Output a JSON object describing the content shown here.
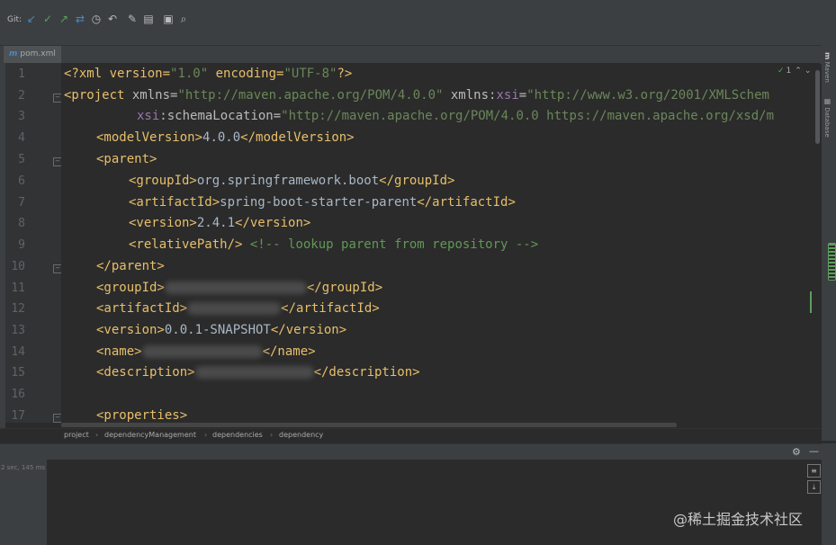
{
  "toolbar": {
    "git_label": "Git:",
    "icons": [
      "update-icon",
      "commit-icon",
      "push-icon",
      "merge-icon",
      "history-icon",
      "rollback-icon",
      "settings-icon",
      "folder-icon",
      "window-icon",
      "search-icon"
    ]
  },
  "tab": {
    "icon_text": "m",
    "filename": "pom.xml"
  },
  "gutter": {
    "line_numbers": [
      "1",
      "2",
      "3",
      "4",
      "5",
      "6",
      "7",
      "8",
      "9",
      "10",
      "11",
      "12",
      "13",
      "14",
      "15",
      "16",
      "17"
    ]
  },
  "code": {
    "l1_a": "<?xml version=",
    "l1_b": "\"1.0\"",
    "l1_c": " encoding=",
    "l1_d": "\"UTF-8\"",
    "l1_e": "?>",
    "l2_a": "<project ",
    "l2_b": "xmlns=",
    "l2_c": "\"http://maven.apache.org/POM/4.0.0\"",
    "l2_d": " xmlns:",
    "l2_e": "xsi",
    "l2_f": "=",
    "l2_g": "\"http://www.w3.org/2001/XMLSchem",
    "l3_a": "xsi",
    "l3_b": ":schemaLocation=",
    "l3_c": "\"http://maven.apache.org/POM/4.0.0 https://maven.apache.org/xsd/m",
    "l4_a": "<modelVersion>",
    "l4_b": "4.0.0",
    "l4_c": "</modelVersion>",
    "l5_a": "<parent>",
    "l6_a": "<groupId>",
    "l6_b": "org.springframework.boot",
    "l6_c": "</groupId>",
    "l7_a": "<artifactId>",
    "l7_b": "spring-boot-starter-parent",
    "l7_c": "</artifactId>",
    "l8_a": "<version>",
    "l8_b": "2.4.1",
    "l8_c": "</version>",
    "l9_a": "<relativePath/>",
    "l9_b": " <!-- lookup parent from repository -->",
    "l10_a": "</parent>",
    "l11_a": "<groupId>",
    "l11_c": "</groupId>",
    "l12_a": "<artifactId>",
    "l12_c": "</artifactId>",
    "l13_a": "<version>",
    "l13_b": "0.0.1-SNAPSHOT",
    "l13_c": "</version>",
    "l14_a": "<name>",
    "l14_c": "</name>",
    "l15_a": "<description>",
    "l15_c": "</description>",
    "l17_a": "<properties>"
  },
  "inspection": {
    "check": "✓",
    "count": "1"
  },
  "right_tools": {
    "maven": "Maven",
    "database": "Database"
  },
  "breadcrumbs": [
    "project",
    "dependencyManagement",
    "dependencies",
    "dependency"
  ],
  "bottom": {
    "status": "2 sec, 145 ms"
  },
  "watermark": "@稀土掘金技术社区",
  "colors": {
    "tag": "#e8bf6a",
    "string": "#6a8759",
    "comment": "#629755",
    "accent": "#4a88c7"
  }
}
